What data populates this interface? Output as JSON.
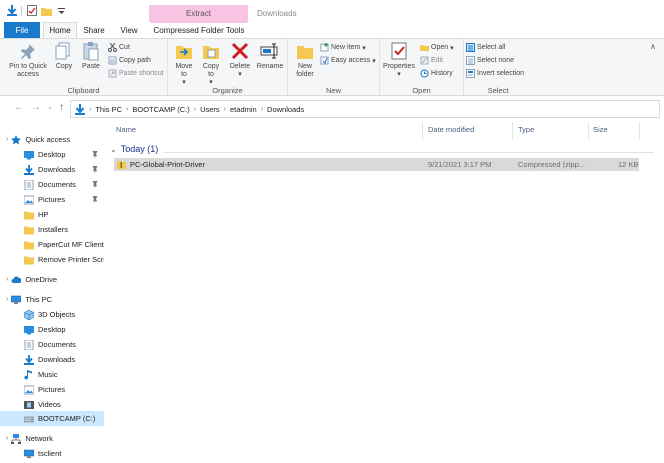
{
  "window": {
    "title": "Downloads",
    "context_tab": "Extract"
  },
  "tabs": {
    "file": "File",
    "home": "Home",
    "share": "Share",
    "view": "View",
    "compressed": "Compressed Folder Tools"
  },
  "ribbon": {
    "clipboard": {
      "label": "Clipboard",
      "pin": "Pin to Quick access",
      "copy": "Copy",
      "paste": "Paste",
      "cut": "Cut",
      "copy_path": "Copy path",
      "paste_shortcut": "Paste shortcut"
    },
    "organize": {
      "label": "Organize",
      "move_to": "Move to",
      "copy_to": "Copy to",
      "delete": "Delete",
      "rename": "Rename"
    },
    "new": {
      "label": "New",
      "new_folder": "New folder",
      "new_item": "New item",
      "easy_access": "Easy access"
    },
    "open": {
      "label": "Open",
      "properties": "Properties",
      "open": "Open",
      "edit": "Edit",
      "history": "History"
    },
    "select": {
      "label": "Select",
      "select_all": "Select all",
      "select_none": "Select none",
      "invert": "Invert selection"
    }
  },
  "address": {
    "crumbs": [
      "This PC",
      "BOOTCAMP (C:)",
      "Users",
      "etadmin",
      "Downloads"
    ]
  },
  "nav": {
    "quick_access": "Quick access",
    "qa_items": [
      "Desktop",
      "Downloads",
      "Documents",
      "Pictures",
      "HP",
      "Installers",
      "PaperCut MF Client",
      "Remove Printer Scri"
    ],
    "onedrive": "OneDrive",
    "this_pc": "This PC",
    "pc_items": [
      "3D Objects",
      "Desktop",
      "Documents",
      "Downloads",
      "Music",
      "Pictures",
      "Videos",
      "BOOTCAMP (C:)"
    ],
    "network": "Network",
    "net_items": [
      "tsclient"
    ]
  },
  "columns": {
    "name": "Name",
    "date": "Date modified",
    "type": "Type",
    "size": "Size"
  },
  "group": {
    "label": "Today (1)"
  },
  "files": [
    {
      "name": "PC-Global-Print-Driver",
      "date": "9/21/2021 3:17 PM",
      "type": "Compressed (zipp...",
      "size": "12 KB"
    }
  ],
  "colors": {
    "accent": "#1979ca",
    "context_tab": "#f9c3e4",
    "selected_row": "#d9d9d9",
    "nav_selected": "#cce8ff"
  }
}
